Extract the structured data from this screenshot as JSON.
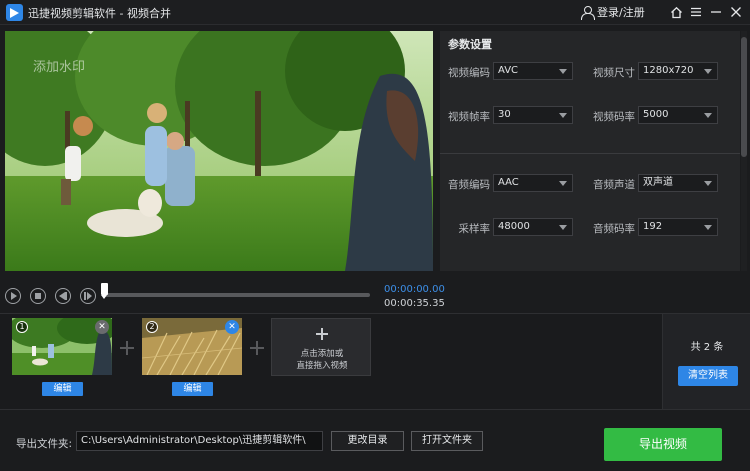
{
  "window": {
    "title": "迅捷视频剪辑软件 - 视频合并",
    "login_label": "登录/注册"
  },
  "preview": {
    "watermark": "添加水印"
  },
  "params": {
    "title": "参数设置",
    "video_codec": {
      "label": "视频编码",
      "value": "AVC"
    },
    "video_size": {
      "label": "视频尺寸",
      "value": "1280x720"
    },
    "frame_rate": {
      "label": "视频帧率",
      "value": "30"
    },
    "video_bitrate": {
      "label": "视频码率",
      "value": "5000"
    },
    "audio_codec": {
      "label": "音频编码",
      "value": "AAC"
    },
    "audio_channel": {
      "label": "音频声道",
      "value": "双声道"
    },
    "sample_rate": {
      "label": "采样率",
      "value": "48000"
    },
    "audio_bitrate": {
      "label": "音频码率",
      "value": "192"
    }
  },
  "player": {
    "current_time": "00:00:00.00",
    "total_time": "00:00:35.35",
    "progress": 0
  },
  "clips": [
    {
      "number": "1",
      "edit_label": "编辑"
    },
    {
      "number": "2",
      "edit_label": "编辑"
    }
  ],
  "add_clip": {
    "line1": "点击添加或",
    "line2": "直接拖入视频"
  },
  "list": {
    "count_text": "共 2 条",
    "clear_label": "清空列表"
  },
  "footer": {
    "output_label": "导出文件夹:",
    "output_path": "C:\\Users\\Administrator\\Desktop\\迅捷剪辑软件\\",
    "change_dir_label": "更改目录",
    "open_folder_label": "打开文件夹",
    "export_label": "导出视频"
  },
  "colors": {
    "accent": "#2e86e6",
    "export": "#33bb44",
    "time_current": "#3d8fe8"
  }
}
